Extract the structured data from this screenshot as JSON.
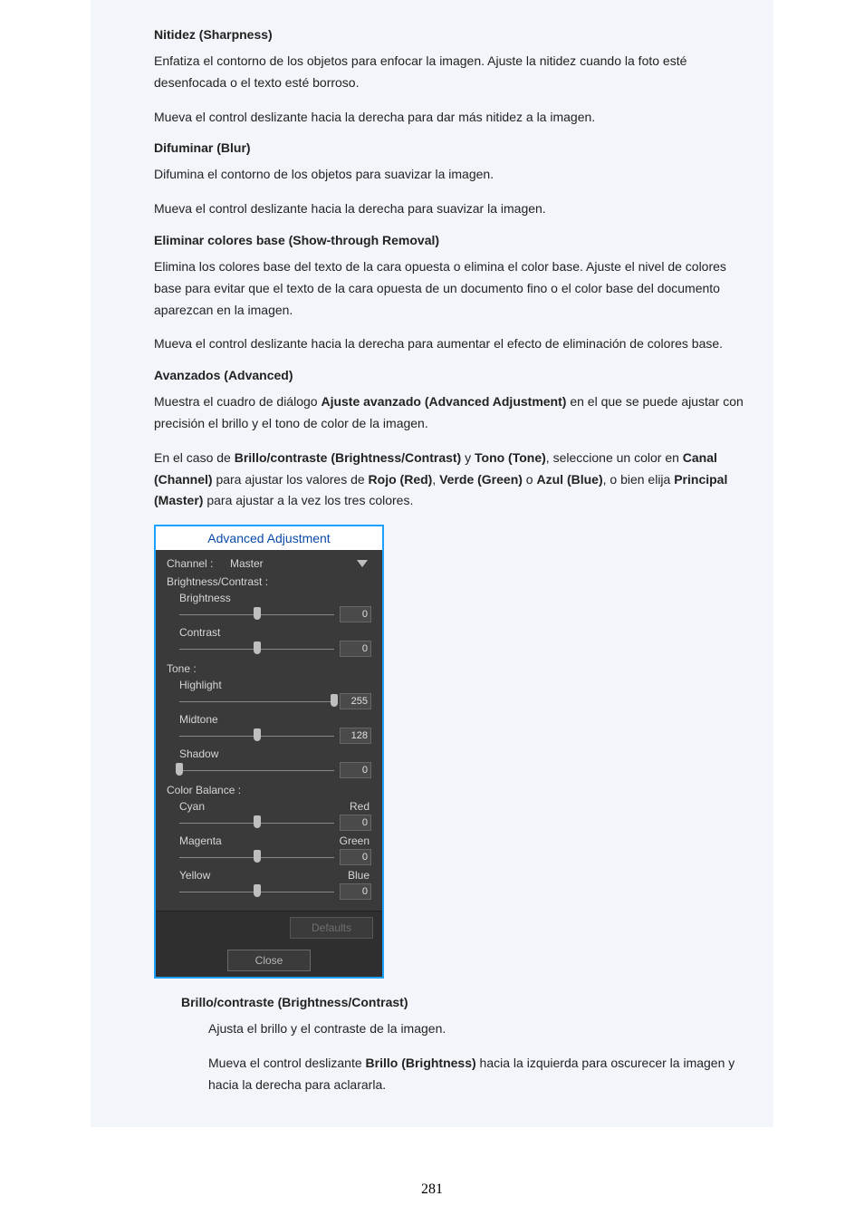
{
  "page_number": "281",
  "sections": {
    "sharpness": {
      "title": "Nitidez (Sharpness)",
      "p1": "Enfatiza el contorno de los objetos para enfocar la imagen. Ajuste la nitidez cuando la foto esté desenfocada o el texto esté borroso.",
      "p2": "Mueva el control deslizante hacia la derecha para dar más nitidez a la imagen."
    },
    "blur": {
      "title": "Difuminar (Blur)",
      "p1": "Difumina el contorno de los objetos para suavizar la imagen.",
      "p2": "Mueva el control deslizante hacia la derecha para suavizar la imagen."
    },
    "showthrough": {
      "title": "Eliminar colores base (Show-through Removal)",
      "p1": "Elimina los colores base del texto de la cara opuesta o elimina el color base. Ajuste el nivel de colores base para evitar que el texto de la cara opuesta de un documento fino o el color base del documento aparezcan en la imagen.",
      "p2": "Mueva el control deslizante hacia la derecha para aumentar el efecto de eliminación de colores base."
    },
    "advanced": {
      "title": "Avanzados (Advanced)",
      "p1_a": "Muestra el cuadro de diálogo ",
      "p1_b": "Ajuste avanzado (Advanced Adjustment)",
      "p1_c": " en el que se puede ajustar con precisión el brillo y el tono de color de la imagen.",
      "p2_a": "En el caso de ",
      "p2_b": "Brillo/contraste (Brightness/Contrast)",
      "p2_c": " y ",
      "p2_d": "Tono (Tone)",
      "p2_e": ", seleccione un color en ",
      "p2_f": "Canal (Channel)",
      "p2_g": " para ajustar los valores de ",
      "p2_h": "Rojo (Red)",
      "p2_i": ", ",
      "p2_j": "Verde (Green)",
      "p2_k": " o ",
      "p2_l": "Azul (Blue)",
      "p2_m": ", o bien elija ",
      "p2_n": "Principal (Master)",
      "p2_o": " para ajustar a la vez los tres colores."
    },
    "brightcontrast": {
      "title": "Brillo/contraste (Brightness/Contrast)",
      "p1": "Ajusta el brillo y el contraste de la imagen.",
      "p2_a": "Mueva el control deslizante ",
      "p2_b": "Brillo (Brightness)",
      "p2_c": " hacia la izquierda para oscurecer la imagen y hacia la derecha para aclararla."
    }
  },
  "panel": {
    "title": "Advanced Adjustment",
    "channel_label": "Channel :",
    "channel_value": "Master",
    "bc_label": "Brightness/Contrast :",
    "brightness_label": "Brightness",
    "brightness_value": "0",
    "contrast_label": "Contrast",
    "contrast_value": "0",
    "tone_label": "Tone :",
    "highlight_label": "Highlight",
    "highlight_value": "255",
    "midtone_label": "Midtone",
    "midtone_value": "128",
    "shadow_label": "Shadow",
    "shadow_value": "0",
    "colorbalance_label": "Color Balance :",
    "cb": {
      "cyan_l": "Cyan",
      "cyan_r": "Red",
      "cyan_v": "0",
      "mag_l": "Magenta",
      "mag_r": "Green",
      "mag_v": "0",
      "yel_l": "Yellow",
      "yel_r": "Blue",
      "yel_v": "0"
    },
    "defaults_btn": "Defaults",
    "close_btn": "Close"
  }
}
